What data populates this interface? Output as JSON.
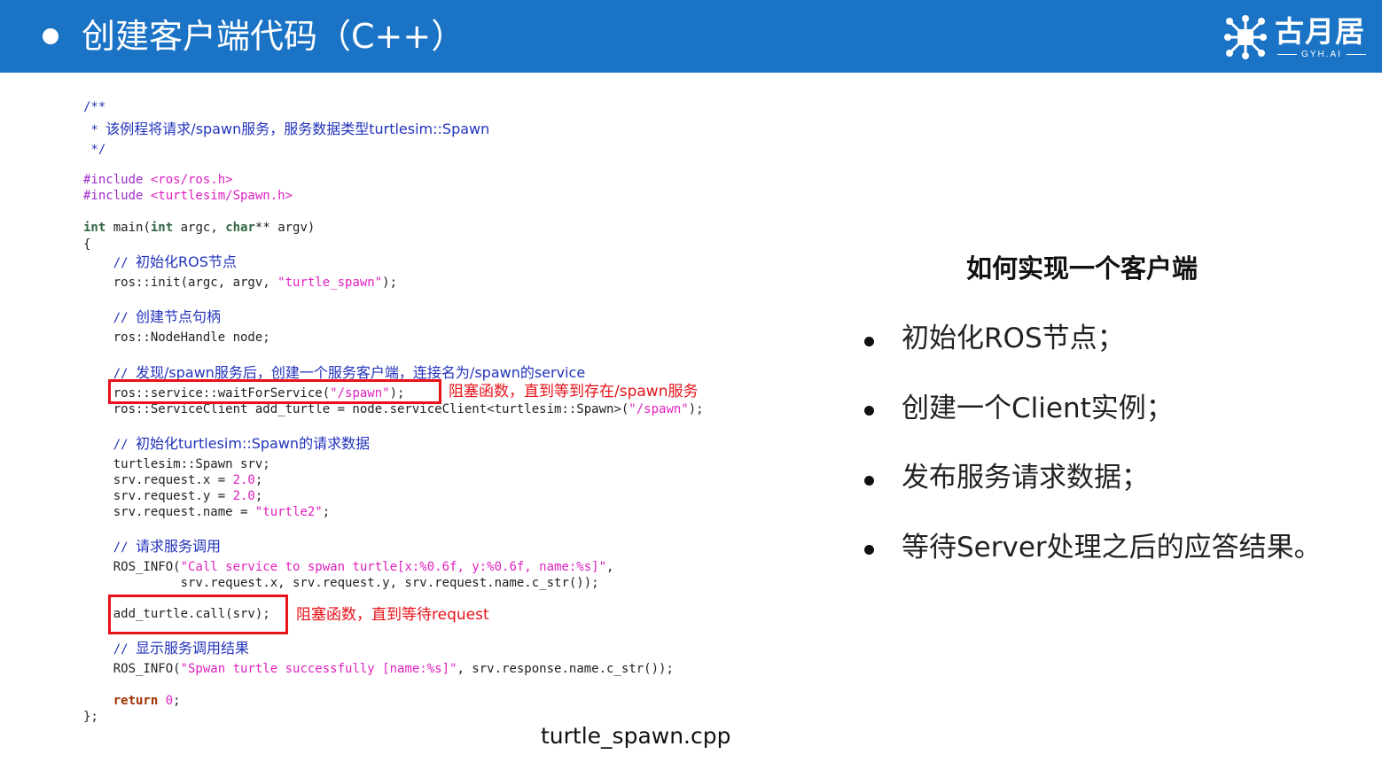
{
  "header": {
    "title": "创建客户端代码（C++）",
    "logo_text": "古月居",
    "logo_sub": "GYH.AI",
    "background": "#1a73c5"
  },
  "code": {
    "l1": "/**",
    "l2_star": " * ",
    "l2_text": "该例程将请求/spawn服务，服务数据类型turtlesim::Spawn",
    "l3": " */",
    "l4_directive": "#include ",
    "l4_file": "<ros/ros.h>",
    "l5_directive": "#include ",
    "l5_file": "<turtlesim/Spawn.h>",
    "l6_int": "int",
    "l6_main": " main(",
    "l6_int2": "int",
    "l6_argc": " argc, ",
    "l6_char": "char",
    "l6_argv": "** argv)",
    "l7": "{",
    "c1_slash": "    // ",
    "c1_text": "初始化ROS节点",
    "l8_a": "    ros::init(argc, argv, ",
    "l8_s": "\"turtle_spawn\"",
    "l8_b": ");",
    "c2_slash": "    // ",
    "c2_text": "创建节点句柄",
    "l9": "    ros::NodeHandle node;",
    "c3_slash": "    // ",
    "c3_text": "发现/spawn服务后，创建一个服务客户端，连接名为/spawn的service",
    "l10_a": "    ros::service::waitForService(",
    "l10_s": "\"/spawn\"",
    "l10_b": ");",
    "l11_a": "    ros::ServiceClient add_turtle = node.serviceClient<turtlesim::Spawn>(",
    "l11_s": "\"/spawn\"",
    "l11_b": ");",
    "c4_slash": "    // ",
    "c4_text": "初始化turtlesim::Spawn的请求数据",
    "l12": "    turtlesim::Spawn srv;",
    "l13_a": "    srv.request.x = ",
    "l13_n": "2.0",
    "l13_b": ";",
    "l14_a": "    srv.request.y = ",
    "l14_n": "2.0",
    "l14_b": ";",
    "l15_a": "    srv.request.name = ",
    "l15_s": "\"turtle2\"",
    "l15_b": ";",
    "c5_slash": "    // ",
    "c5_text": "请求服务调用",
    "l16_a": "    ROS_INFO(",
    "l16_s": "\"Call service to spwan turtle[x:%0.6f, y:%0.6f, name:%s]\"",
    "l16_b": ",",
    "l17": "             srv.request.x, srv.request.y, srv.request.name.c_str());",
    "l18": "    add_turtle.call(srv);",
    "c6_slash": "    // ",
    "c6_text": "显示服务调用结果",
    "l19_a": "    ROS_INFO(",
    "l19_s": "\"Spwan turtle successfully [name:%s]\"",
    "l19_b": ", srv.response.name.c_str());",
    "l20_ret": "return",
    "l20_sp": "    ",
    "l20_zero": "0",
    "l20_b": ";",
    "l21": "};"
  },
  "annotations": {
    "note1": "阻塞函数，直到等到存在/spawn服务",
    "note2": "阻塞函数，直到等待request",
    "highlight_color": "#e8121a"
  },
  "filename": "turtle_spawn.cpp",
  "right_panel": {
    "title": "如何实现一个客户端",
    "bullets": [
      "初始化ROS节点；",
      "创建一个Client实例；",
      "发布服务请求数据；",
      "等待Server处理之后的应答结果。"
    ]
  }
}
